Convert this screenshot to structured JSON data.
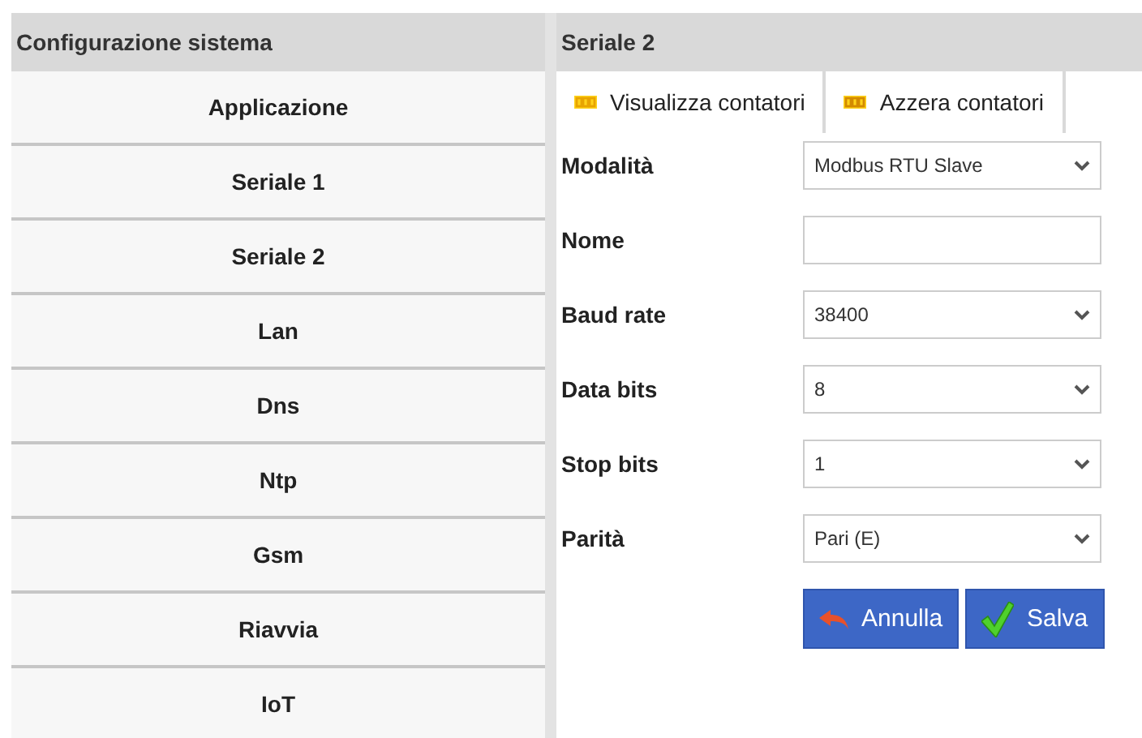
{
  "sidebar": {
    "title": "Configurazione sistema",
    "items": [
      {
        "label": "Applicazione"
      },
      {
        "label": "Seriale 1"
      },
      {
        "label": "Seriale 2"
      },
      {
        "label": "Lan"
      },
      {
        "label": "Dns"
      },
      {
        "label": "Ntp"
      },
      {
        "label": "Gsm"
      },
      {
        "label": "Riavvia"
      },
      {
        "label": "IoT"
      }
    ]
  },
  "panel": {
    "title": "Seriale 2",
    "toolbar": [
      {
        "label": "Visualizza contatori",
        "kind": "view"
      },
      {
        "label": "Azzera contatori",
        "kind": "reset"
      }
    ],
    "fields": [
      {
        "label": "Modalità",
        "kind": "select",
        "value": "Modbus RTU Slave"
      },
      {
        "label": "Nome",
        "kind": "text"
      },
      {
        "label": "Baud rate",
        "kind": "select",
        "value": "38400"
      },
      {
        "label": "Data bits",
        "kind": "select",
        "value": "8"
      },
      {
        "label": "Stop bits",
        "kind": "select",
        "value": "1"
      },
      {
        "label": "Parità",
        "kind": "select",
        "value": "Pari (E)"
      }
    ],
    "buttons": [
      {
        "label": "Annulla",
        "kind": "cancel"
      },
      {
        "label": "Salva",
        "kind": "save"
      }
    ]
  }
}
